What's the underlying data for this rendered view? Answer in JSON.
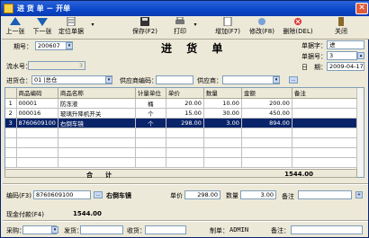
{
  "window": {
    "title": "进 货 单 － 开单",
    "close": "✕"
  },
  "toolbar": {
    "prev": "上一张",
    "next": "下一张",
    "locate": "定位单据",
    "save": "保存(F2)",
    "print": "打印",
    "add": "增加(F7)",
    "edit": "修改(F8)",
    "delete": "删除(DEL)",
    "close": "关闭"
  },
  "form": {
    "period_label": "期号：",
    "period_value": "200607",
    "heading": "进 货 单",
    "doc_type_label": "单据字：",
    "doc_type_value": "进",
    "doc_no_label": "单据号：",
    "doc_no_value": "3",
    "date_label": "日　期：",
    "date_value": "2009-04-17",
    "serial_label": "流水号：",
    "serial_value": "3",
    "warehouse_label": "进货仓：",
    "warehouse_value": "01 |总仓",
    "supplier_code_label": "供应商编码：",
    "supplier_code_value": "",
    "supplier_label": "供应商：",
    "supplier_value": "",
    "more_btn": "..."
  },
  "grid": {
    "columns": [
      "",
      "商品编码",
      "商品名称",
      "计量单位",
      "单价",
      "数量",
      "金额",
      "备注"
    ],
    "rows": [
      {
        "idx": "1",
        "code": "00001",
        "name": "防冻液",
        "unit": "桶",
        "price": "20.00",
        "qty": "10.00",
        "amount": "200.00",
        "note": ""
      },
      {
        "idx": "2",
        "code": "000016",
        "name": "玻璃升降机开关",
        "unit": "个",
        "price": "15.00",
        "qty": "30.00",
        "amount": "450.00",
        "note": ""
      },
      {
        "idx": "3",
        "code": "8760609100",
        "name": "右倒车镜",
        "unit": "个",
        "price": "298.00",
        "qty": "3.00",
        "amount": "894.00",
        "note": ""
      }
    ],
    "total_label": "合　　计",
    "total_value": "1544.00"
  },
  "detail": {
    "code_label": "编码(F3)",
    "code_value": "8760609100",
    "name_value": "右倒车镜",
    "price_label": "单价",
    "price_value": "298.00",
    "qty_label": "数量",
    "qty_value": "3.00",
    "note_label": "备注",
    "note_value": "",
    "cash_label": "现金付款(F4)",
    "cash_value": "1544.00"
  },
  "footer": {
    "buyer_label": "采购：",
    "buyer_value": "",
    "shipper_label": "发货：",
    "shipper_value": "",
    "receiver_label": "收货：",
    "receiver_value": "",
    "maker_label": "制单：",
    "maker_value": "ADMIN",
    "remark_label": "备注：",
    "remark_value": ""
  }
}
